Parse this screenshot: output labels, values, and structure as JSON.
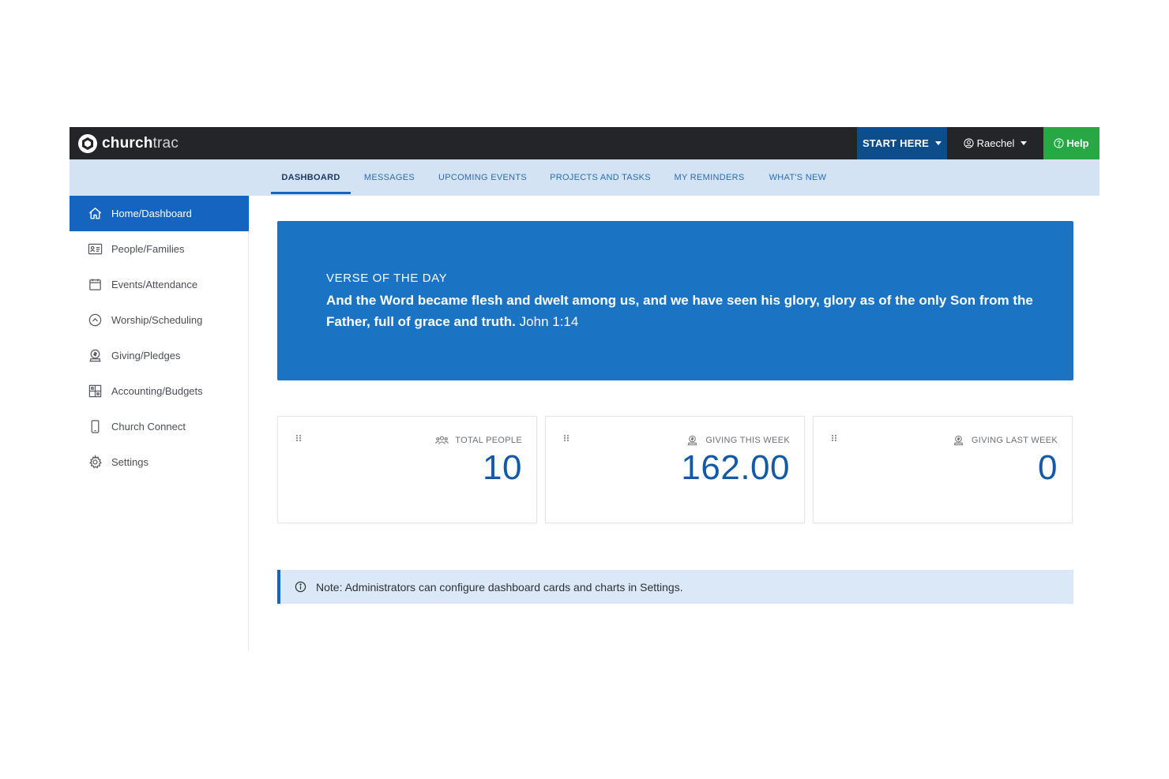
{
  "app": {
    "brand_bold": "church",
    "brand_light": "trac"
  },
  "header": {
    "start_label": "START HERE",
    "user_label": "Raechel",
    "help_label": "Help"
  },
  "tabs": [
    {
      "label": "DASHBOARD",
      "active": true
    },
    {
      "label": "MESSAGES",
      "active": false
    },
    {
      "label": "UPCOMING EVENTS",
      "active": false
    },
    {
      "label": "PROJECTS AND TASKS",
      "active": false
    },
    {
      "label": "MY REMINDERS",
      "active": false
    },
    {
      "label": "WHAT'S NEW",
      "active": false
    }
  ],
  "sidebar": {
    "items": [
      {
        "label": "Home/Dashboard",
        "icon": "home-icon",
        "active": true
      },
      {
        "label": "People/Families",
        "icon": "id-card-icon",
        "active": false
      },
      {
        "label": "Events/Attendance",
        "icon": "calendar-icon",
        "active": false
      },
      {
        "label": "Worship/Scheduling",
        "icon": "chevron-circle-icon",
        "active": false
      },
      {
        "label": "Giving/Pledges",
        "icon": "giving-icon",
        "active": false
      },
      {
        "label": "Accounting/Budgets",
        "icon": "grid-icon",
        "active": false
      },
      {
        "label": "Church Connect",
        "icon": "phone-icon",
        "active": false
      },
      {
        "label": "Settings",
        "icon": "gear-icon",
        "active": false
      }
    ]
  },
  "verse": {
    "title": "VERSE OF THE DAY",
    "text": "And the Word became flesh and dwelt among us, and we have seen his glory, glory as of the only Son from the Father, full of grace and truth.",
    "reference": "John 1:14"
  },
  "cards": [
    {
      "label": "TOTAL PEOPLE",
      "value": "10",
      "icon": "people-icon"
    },
    {
      "label": "GIVING THIS WEEK",
      "value": "162.00",
      "icon": "giving-icon"
    },
    {
      "label": "GIVING LAST WEEK",
      "value": "0",
      "icon": "giving-icon"
    }
  ],
  "note": {
    "text": "Note: Administrators can configure dashboard cards and charts in Settings."
  },
  "colors": {
    "topbar": "#232528",
    "primary": "#1565c0",
    "start_button": "#0e4d8b",
    "help_button": "#28a745",
    "tabbar": "#d3e3f4",
    "verse_bg": "#1a73c3",
    "value_text": "#125aa8",
    "note_bg": "#dae8f7"
  }
}
